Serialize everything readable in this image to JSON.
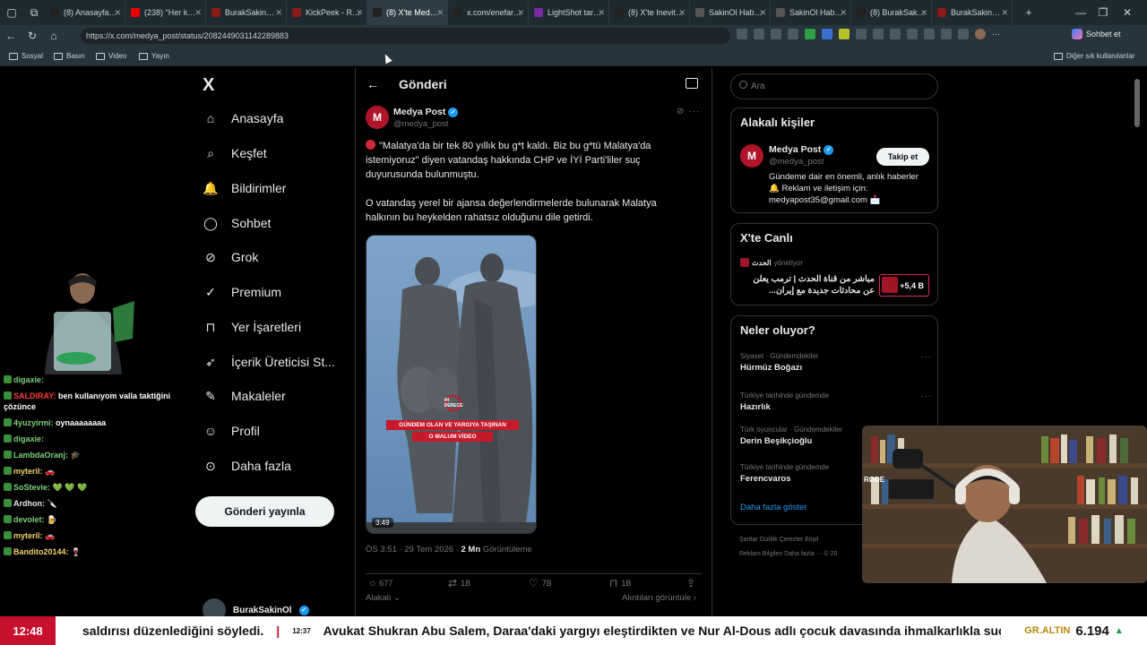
{
  "browser": {
    "tabs": [
      {
        "label": "(8) Anasayfa / X",
        "color": "#222"
      },
      {
        "label": "(238) \"Her kurs...",
        "color": "#e00"
      },
      {
        "label": "BurakSakinOl G...",
        "color": "#8b1a1a"
      },
      {
        "label": "KickPeek - Real...",
        "color": "#8b1a1a"
      },
      {
        "label": "(8) X'te Medya...",
        "color": "#222"
      },
      {
        "label": "x.com/enefarks...",
        "color": "#222"
      },
      {
        "label": "LightShot taraf...",
        "color": "#7a2aa0"
      },
      {
        "label": "(8) X'te Inevita...",
        "color": "#222"
      },
      {
        "label": "SakinOl Haber...",
        "color": "#555"
      },
      {
        "label": "SakinOl Haber...",
        "color": "#555"
      },
      {
        "label": "(8) BurakSakinO...",
        "color": "#222"
      },
      {
        "label": "BurakSakinOl G...",
        "color": "#8b1a1a"
      }
    ],
    "active_tab": 4,
    "url": "https://x.com/medya_post/status/2082449031142289883",
    "sohbet_label": "Sohbet et",
    "bookmarks": [
      "Sosyal",
      "Basın",
      "Video",
      "Yayın"
    ],
    "other_bookmarks": "Diğer sık kullanılanlar"
  },
  "nav": {
    "logo": "X",
    "items": [
      "Anasayfa",
      "Keşfet",
      "Bildirimler",
      "Sohbet",
      "Grok",
      "Premium",
      "Yer İşaretleri",
      "İçerik Üreticisi St...",
      "Makaleler",
      "Profil",
      "Daha fazla"
    ],
    "post_button": "Gönderi yayınla",
    "me_name": "BurakSakinOl"
  },
  "post": {
    "header": "Gönderi",
    "author_name": "Medya Post",
    "author_handle": "@medya_post",
    "avatar_letter": "M",
    "text_p1": "\"Malatya'da bir tek 80 yıllık bu g*t kaldı. Biz bu g*tü Malatya'da istemiyoruz\" diyen vatandaş hakkında CHP ve İYİ Parti'liler suç duyurusunda bulunmuştu.",
    "text_p2": "O vatandaş yerel bir ajansa değerlendirmelerde bulunarak Malatya halkının bu heykelden rahatsız olduğunu dile getirdi.",
    "video_caption_1": "GÜNDEM OLAN VE YARGIYA TAŞINAN",
    "video_caption_2": "O MALUM VİDEO",
    "video_logo": "44 DERECE",
    "video_duration": "3:49",
    "time": "ÖS 3:51 · 29 Tem 2026 · ",
    "views_count": "2 Mn",
    "views_label": " Görüntüleme",
    "replies": "677",
    "reposts": "1B",
    "likes": "7B",
    "bookmarks": "1B",
    "related": "Alakalı",
    "quotes": "Alıntıları görüntüle"
  },
  "sidebar": {
    "search_placeholder": "Ara",
    "related_title": "Alakalı kişiler",
    "rp_name": "Medya Post",
    "rp_handle": "@medya_post",
    "follow": "Takip et",
    "bio": "Gündeme dair en önemli, anlık haberler 🔔 Reklam ve iletişim için: medyapost35@gmail.com 📩",
    "live_title": "X'te Canlı",
    "live_host": "الحدث",
    "live_host_role": "yönetiyor",
    "live_text": "مباشر من قناة الحدث | ترمب يعلن عن محادثات جديدة مع إيران...",
    "live_count": "+5,4 B",
    "trends_title": "Neler oluyor?",
    "trends": [
      {
        "meta": "Siyaset · Gündemdekiler",
        "name": "Hürmüz Boğazı"
      },
      {
        "meta": "Türkiye tarihinde gündemde",
        "name": "Hazırlık"
      },
      {
        "meta": "Türk oyuncular · Gündemdekiler",
        "name": "Derin Beşikçioğlu"
      },
      {
        "meta": "Türkiye tarihinde gündemde",
        "name": "Ferencvaros"
      }
    ],
    "show_more": "Daha fazla göster",
    "footer_1": "Şartlar    Gizlilik    Çerezler    Erişil",
    "footer_2": "Reklam Bilgileri    Daha fazla ···    © 20"
  },
  "chat": [
    {
      "user": "digaxie:",
      "msg": "",
      "color": "#7cd17c"
    },
    {
      "user": "SALDIRAY:",
      "msg": "ben kullanıyom valla taktiğini çözünce",
      "color": "#ff3b3b"
    },
    {
      "user": "4yuzyirmi:",
      "msg": "oynaaaaaaaa",
      "color": "#7cd17c"
    },
    {
      "user": "digaxie:",
      "msg": "",
      "color": "#7cd17c"
    },
    {
      "user": "LambdaOranj:",
      "msg": "🎓",
      "color": "#7cd17c"
    },
    {
      "user": "myteril:",
      "msg": "🚗",
      "color": "#f2d16b"
    },
    {
      "user": "SoStevie:",
      "msg": "💚 💚 💚",
      "color": "#7cd17c"
    },
    {
      "user": "Ardhon:",
      "msg": "🔪",
      "color": "#e7e9ea"
    },
    {
      "user": "devolet:",
      "msg": "🍺",
      "color": "#7cd17c"
    },
    {
      "user": "myteril:",
      "msg": "🚗",
      "color": "#f2d16b"
    },
    {
      "user": "Bandito20144:",
      "msg": "🍷",
      "color": "#f2d16b"
    }
  ],
  "lower_third": {
    "clock": "12:48",
    "ticker_1": "saldırısı düzenlediğini söyledi.",
    "ticker_time": "12:37",
    "ticker_2": "Avukat Shukran Abu Salem, Daraa'daki yargıyı eleştirdikten ve Nur Al-Dous adlı çocuk davasında ihmalkarlıkla suç",
    "gold_label": "GR.ALTIN",
    "gold_value": "6.194",
    "gold_arrow": "▲"
  },
  "webcam_text": "RØDE"
}
